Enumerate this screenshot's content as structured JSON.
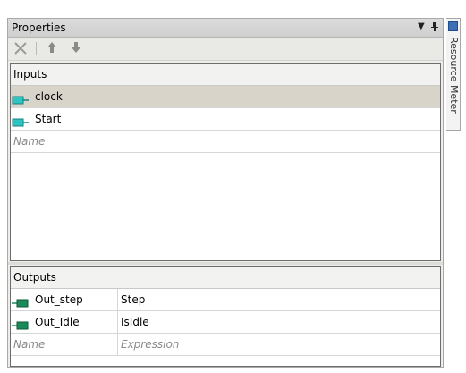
{
  "panel": {
    "title": "Properties",
    "dropdown_icon": "dropdown-arrow-icon",
    "pin_icon": "pin-icon"
  },
  "toolbar": {
    "delete_icon": "delete-x-icon",
    "move_up_icon": "arrow-up-icon",
    "move_down_icon": "arrow-down-icon"
  },
  "inputs": {
    "header": "Inputs",
    "rows": [
      {
        "name": "clock",
        "selected": true
      },
      {
        "name": "Start",
        "selected": false
      }
    ],
    "placeholder": "Name"
  },
  "outputs": {
    "header": "Outputs",
    "rows": [
      {
        "name": "Out_step",
        "expression": "Step"
      },
      {
        "name": "Out_Idle",
        "expression": "IsIdle"
      }
    ],
    "placeholder_name": "Name",
    "placeholder_expression": "Expression"
  },
  "side_tab": {
    "label": "Resource Meter"
  },
  "colors": {
    "input_pin": "#2ec4c4",
    "output_pin": "#1a8a5a",
    "selected_row": "#d9d4c9"
  }
}
